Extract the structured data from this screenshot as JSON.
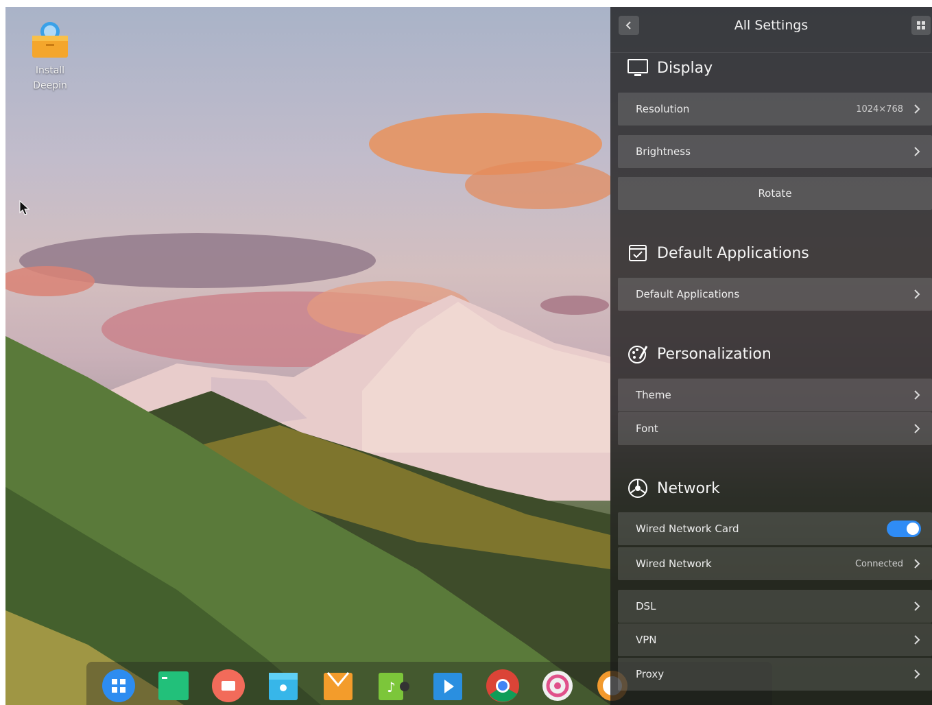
{
  "desktop": {
    "icon_label_line1": "Install",
    "icon_label_line2": "Deepin",
    "icon_name": "install-deepin-icon"
  },
  "settings": {
    "title": "All Settings",
    "sections": {
      "display": {
        "title": "Display",
        "resolution_label": "Resolution",
        "resolution_value": "1024×768",
        "brightness_label": "Brightness",
        "rotate_label": "Rotate"
      },
      "default_apps": {
        "title": "Default Applications",
        "row_label": "Default Applications"
      },
      "personalization": {
        "title": "Personalization",
        "theme_label": "Theme",
        "font_label": "Font"
      },
      "network": {
        "title": "Network",
        "wired_card_label": "Wired Network Card",
        "wired_card_enabled": true,
        "wired_network_label": "Wired Network",
        "wired_network_status": "Connected",
        "dsl_label": "DSL",
        "vpn_label": "VPN",
        "proxy_label": "Proxy"
      }
    }
  },
  "colors": {
    "toggle_on": "#2f8cf5",
    "panel_bg": "rgba(25,25,25,0.78)"
  },
  "dock": {
    "items": [
      "launcher-icon",
      "terminal-icon",
      "screen-recorder-icon",
      "file-manager-icon",
      "app-store-icon",
      "music-icon",
      "video-icon",
      "chrome-icon",
      "settings-icon",
      "deepin-icon"
    ]
  }
}
